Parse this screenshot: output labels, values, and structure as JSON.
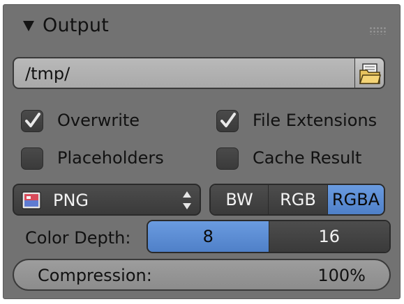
{
  "panel": {
    "title": "Output",
    "expand_icon": "triangle-down-icon",
    "grip_icon": "drag-grip-icon"
  },
  "output_path": {
    "value": "/tmp/",
    "browse_icon": "folder-icon"
  },
  "options": {
    "overwrite": {
      "label": "Overwrite",
      "checked": true
    },
    "file_extensions": {
      "label": "File Extensions",
      "checked": true
    },
    "placeholders": {
      "label": "Placeholders",
      "checked": false
    },
    "cache_result": {
      "label": "Cache Result",
      "checked": false
    }
  },
  "file_format": {
    "selected": "PNG",
    "icon": "image-file-icon"
  },
  "color_mode": {
    "options": [
      "BW",
      "RGB",
      "RGBA"
    ],
    "selected": "RGBA"
  },
  "color_depth": {
    "label": "Color Depth:",
    "options": [
      "8",
      "16"
    ],
    "selected": "8"
  },
  "compression": {
    "label": "Compression:",
    "value": "100%"
  },
  "colors": {
    "panel_bg": "#727272",
    "accent": "#5b8bd4",
    "widget_dark": "#434343"
  }
}
